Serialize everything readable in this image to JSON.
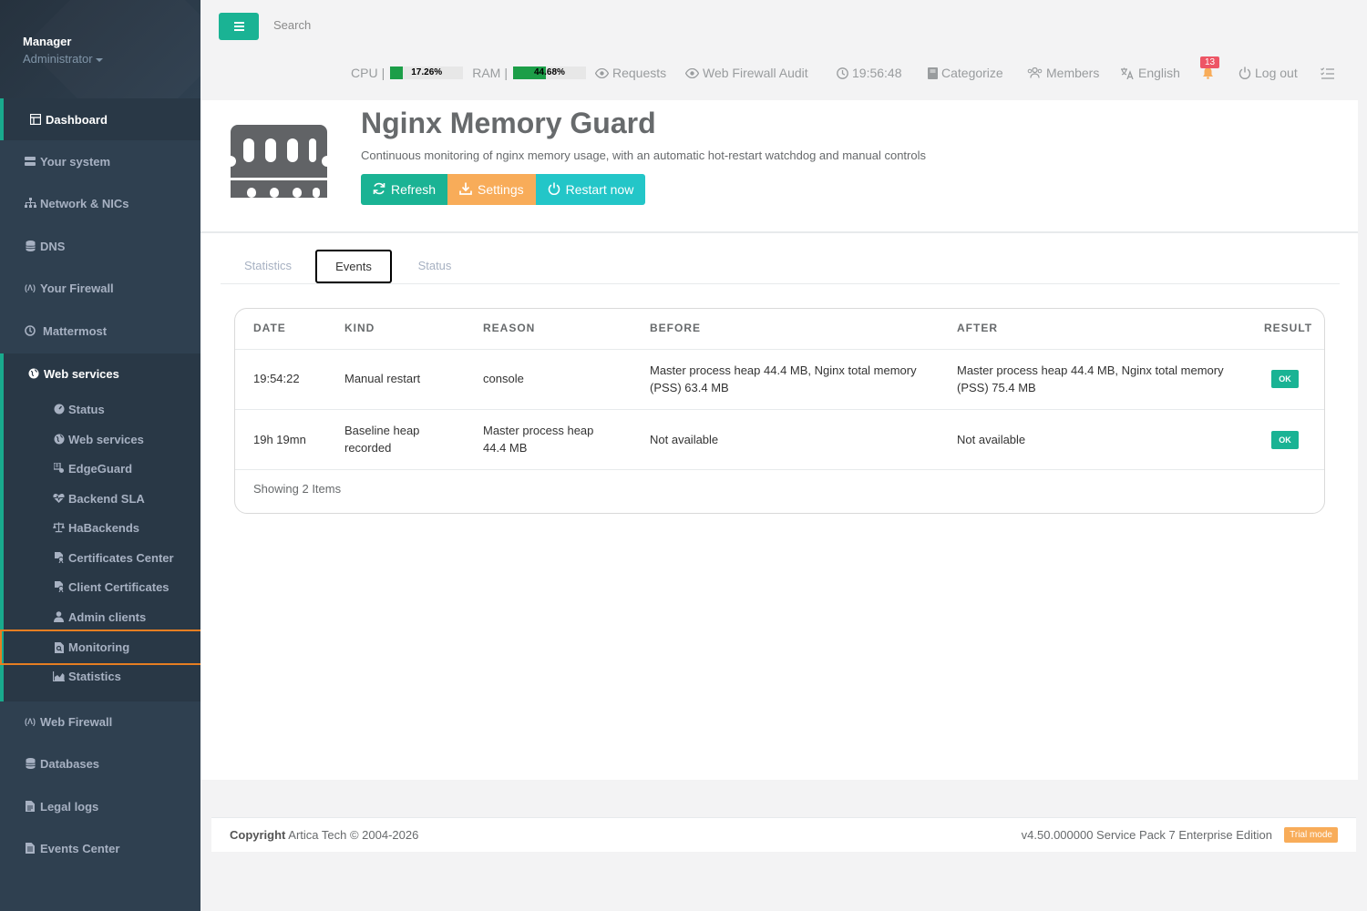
{
  "profile": {
    "name": "Manager",
    "role": "Administrator"
  },
  "sidebar": {
    "items": [
      {
        "label": "Dashboard",
        "icon": "dashboard-icon"
      },
      {
        "label": "Your system",
        "icon": "server-icon"
      },
      {
        "label": "Network & NICs",
        "icon": "network-icon"
      },
      {
        "label": "DNS",
        "icon": "database-icon"
      },
      {
        "label": "Your Firewall",
        "icon": "firewall-icon"
      },
      {
        "label": "Mattermost",
        "icon": "mattermost-icon"
      },
      {
        "label": "Web services",
        "icon": "globe-icon"
      },
      {
        "label": "Web Firewall",
        "icon": "firewall-icon"
      },
      {
        "label": "Databases",
        "icon": "database-icon"
      },
      {
        "label": "Legal logs",
        "icon": "file-icon"
      },
      {
        "label": "Events Center",
        "icon": "file-text-icon"
      }
    ],
    "sub_items": [
      {
        "label": "Status",
        "icon": "dashboard-gauge-icon"
      },
      {
        "label": "Web services",
        "icon": "globe-icon"
      },
      {
        "label": "EdgeGuard",
        "icon": "edgeguard-icon"
      },
      {
        "label": "Backend SLA",
        "icon": "heartbeat-icon"
      },
      {
        "label": "HaBackends",
        "icon": "balance-scale-icon"
      },
      {
        "label": "Certificates Center",
        "icon": "certificate-icon"
      },
      {
        "label": "Client Certificates",
        "icon": "certificate-icon"
      },
      {
        "label": "Admin clients",
        "icon": "user-icon"
      },
      {
        "label": "Monitoring",
        "icon": "file-search-icon"
      },
      {
        "label": "Statistics",
        "icon": "area-chart-icon"
      }
    ]
  },
  "topbar": {
    "search_placeholder": "Search",
    "cpu_label": "CPU",
    "cpu_value": "17.26%",
    "cpu_percent": 17.26,
    "ram_label": "RAM",
    "ram_value": "44.68%",
    "ram_percent": 44.68,
    "requests": "Requests",
    "web_firewall_audit": "Web Firewall Audit",
    "time": "19:56:48",
    "categorize": "Categorize",
    "members": "Members",
    "language": "English",
    "notifications": "13",
    "logout": "Log out",
    "separator": "|"
  },
  "page": {
    "title": "Nginx Memory Guard",
    "subtitle": "Continuous monitoring of nginx memory usage, with an automatic hot-restart watchdog and manual controls",
    "buttons": {
      "refresh": "Refresh",
      "settings": "Settings",
      "restart": "Restart now"
    }
  },
  "tabs": [
    {
      "label": "Statistics",
      "active": false
    },
    {
      "label": "Events",
      "active": true
    },
    {
      "label": "Status",
      "active": false
    }
  ],
  "table": {
    "columns": [
      "DATE",
      "KIND",
      "REASON",
      "BEFORE",
      "AFTER",
      "RESULT"
    ],
    "rows": [
      {
        "date": "19:54:22",
        "kind": "Manual restart",
        "reason": "console",
        "before": "Master process heap 44.4 MB, Nginx total memory (PSS) 63.4 MB",
        "after": "Master process heap 44.4 MB, Nginx total memory (PSS) 75.4 MB",
        "result": "OK"
      },
      {
        "date": "19h 19mn",
        "kind": "Baseline heap recorded",
        "reason": "Master process heap 44.4 MB",
        "before": "Not available",
        "after": "Not available",
        "result": "OK"
      }
    ],
    "footer": "Showing 2 Items"
  },
  "footer": {
    "copyright_label": "Copyright",
    "copyright_text": "Artica Tech © 2004-2026",
    "version": "v4.50.000000 Service Pack 7 Enterprise Edition",
    "trial": "Trial mode"
  },
  "colors": {
    "sidebar_bg": "#2f4050",
    "accent_green": "#1ab394",
    "accent_orange": "#f8ac59",
    "accent_cyan": "#23c6c8",
    "highlight_outline": "#e67e22",
    "badge_red": "#ed5565"
  }
}
